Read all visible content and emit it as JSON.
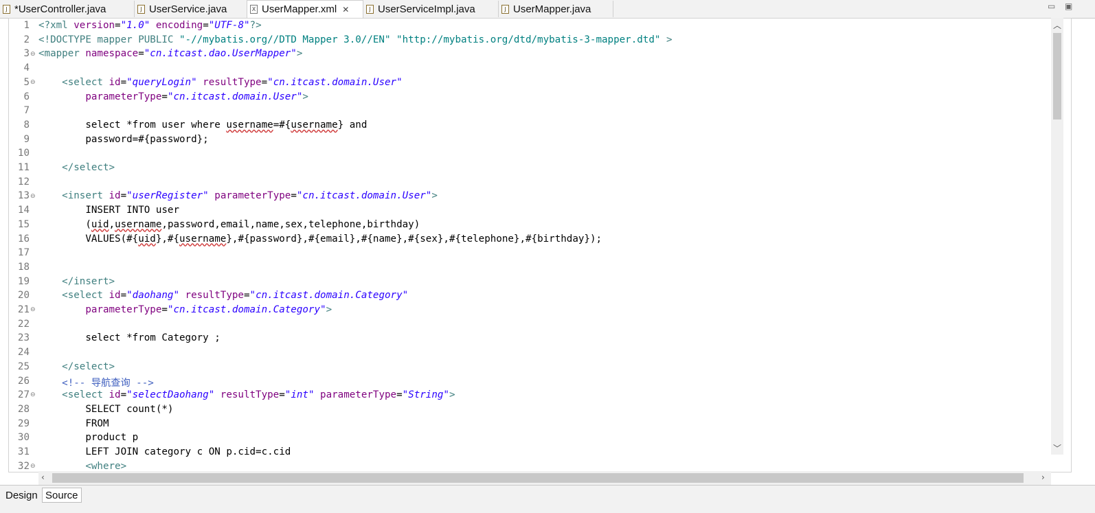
{
  "tabs": [
    {
      "label": "*UserController.java",
      "icon": "java-file-icon"
    },
    {
      "label": "UserService.java",
      "icon": "java-file-icon"
    },
    {
      "label": "UserMapper.xml",
      "icon": "xml-file-icon",
      "active": true
    },
    {
      "label": "UserServiceImpl.java",
      "icon": "java-file-icon"
    },
    {
      "label": "UserMapper.java",
      "icon": "java-file-icon"
    }
  ],
  "bottom_tabs": [
    {
      "label": "Design"
    },
    {
      "label": "Source",
      "active": true
    }
  ],
  "line_numbers": [
    "1",
    "2",
    "3",
    "4",
    "5",
    "6",
    "7",
    "8",
    "9",
    "10",
    "11",
    "12",
    "13",
    "14",
    "15",
    "16",
    "17",
    "18",
    "19",
    "20",
    "21",
    "22",
    "23",
    "24",
    "25",
    "26",
    "27",
    "28",
    "29",
    "30",
    "31",
    "32"
  ],
  "code": {
    "l1": {
      "p1": "<?xml ",
      "a1": "version",
      "e1": "=",
      "v1": "\"1.0\"",
      "a2": " encoding",
      "e2": "=",
      "v2": "\"UTF-8\"",
      "p2": "?>"
    },
    "l2": {
      "p1": "<!DOCTYPE ",
      "t1": "mapper",
      "p2": " PUBLIC ",
      "q1": "\"-//mybatis.org//DTD Mapper 3.0//EN\"",
      "q2": " \"http://mybatis.org/dtd/mybatis-3-mapper.dtd\"",
      "p3": " >"
    },
    "l3": {
      "t1": "<mapper",
      "a1": " namespace",
      "e1": "=",
      "v1": "\"cn.itcast.dao.UserMapper\"",
      "t2": ">"
    },
    "l5": {
      "t1": "<select",
      "a1": " id",
      "e1": "=",
      "v1": "\"queryLogin\"",
      "a2": " resultType",
      "e2": "=",
      "v2": "\"cn.itcast.domain.User\""
    },
    "l6": {
      "a1": "parameterType",
      "e1": "=",
      "v1": "\"cn.itcast.domain.User\"",
      "t1": ">"
    },
    "l8": {
      "p1": "select *from user where ",
      "s1": "username",
      "p2": "=#{",
      "s2": "username",
      "p3": "} and"
    },
    "l9": {
      "p1": "password=#{password};"
    },
    "l11": {
      "t1": "</select>"
    },
    "l13": {
      "t1": "<insert",
      "a1": " id",
      "e1": "=",
      "v1": "\"userRegister\"",
      "a2": " parameterType",
      "e2": "=",
      "v2": "\"cn.itcast.domain.User\"",
      "t2": ">"
    },
    "l14": {
      "p1": "INSERT INTO user"
    },
    "l15": {
      "p1": "(",
      "s1": "uid",
      "p2": ",",
      "s2": "username",
      "p3": ",password,email,name,sex,telephone,birthday)"
    },
    "l16": {
      "p1": "VALUES(#{",
      "s1": "uid",
      "p2": "},#{",
      "s2": "username",
      "p3": "},#{password},#{email},#{name},#{sex},#{telephone},#{birthday});"
    },
    "l19": {
      "t1": "</insert>"
    },
    "l20": {
      "t1": "<select",
      "a1": " id",
      "e1": "=",
      "v1": "\"daohang\"",
      "a2": " resultType",
      "e2": "=",
      "v2": "\"cn.itcast.domain.Category\""
    },
    "l21": {
      "a1": "parameterType",
      "e1": "=",
      "v1": "\"cn.itcast.domain.Category\"",
      "t1": ">"
    },
    "l23": {
      "p1": "select *from Category ;"
    },
    "l25": {
      "t1": "</select>"
    },
    "l26": {
      "c1": "<!-- 导航查询 -->"
    },
    "l27": {
      "t1": "<select",
      "a1": " id",
      "e1": "=",
      "v1": "\"selectDaohang\"",
      "a2": " resultType",
      "e2": "=",
      "v2": "\"int\"",
      "a3": " parameterType",
      "e3": "=",
      "v3": "\"String\"",
      "t2": ">"
    },
    "l28": {
      "p1": "SELECT count(*)"
    },
    "l29": {
      "p1": "FROM"
    },
    "l30": {
      "p1": "product p"
    },
    "l31": {
      "p1": "LEFT JOIN category c ON p.cid=c.cid"
    },
    "l32": {
      "t1": "<where>"
    }
  },
  "colors": {
    "tag": "#3f7f7f",
    "attribute": "#7f007f",
    "value": "#2a00ff",
    "comment": "#3f5fbf"
  }
}
